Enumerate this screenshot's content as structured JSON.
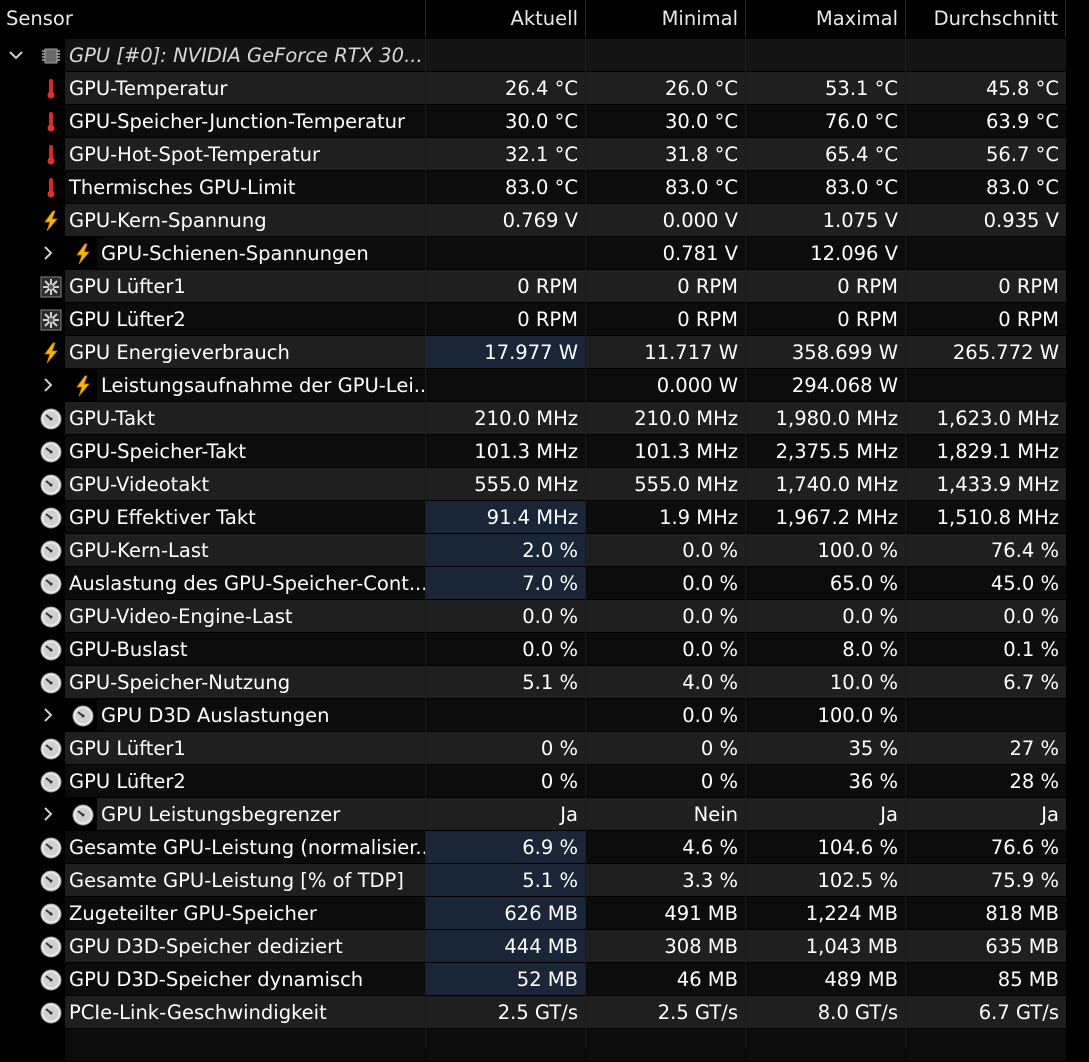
{
  "header": {
    "sensor": "Sensor",
    "current": "Aktuell",
    "min": "Minimal",
    "max": "Maximal",
    "avg": "Durchschnitt"
  },
  "group": {
    "label": "GPU [#0]: NVIDIA GeForce RTX 30...",
    "icon": "chip-icon"
  },
  "rows": [
    {
      "name": "GPU-Temperatur",
      "icon": "thermometer-icon",
      "cur": "26.4 °C",
      "min": "26.0 °C",
      "max": "53.1 °C",
      "avg": "45.8 °C"
    },
    {
      "name": "GPU-Speicher-Junction-Temperatur",
      "icon": "thermometer-icon",
      "cur": "30.0 °C",
      "min": "30.0 °C",
      "max": "76.0 °C",
      "avg": "63.9 °C"
    },
    {
      "name": "GPU-Hot-Spot-Temperatur",
      "icon": "thermometer-icon",
      "cur": "32.1 °C",
      "min": "31.8 °C",
      "max": "65.4 °C",
      "avg": "56.7 °C"
    },
    {
      "name": "Thermisches GPU-Limit",
      "icon": "thermometer-icon",
      "cur": "83.0 °C",
      "min": "83.0 °C",
      "max": "83.0 °C",
      "avg": "83.0 °C"
    },
    {
      "name": "GPU-Kern-Spannung",
      "icon": "lightning-icon",
      "cur": "0.769 V",
      "min": "0.000 V",
      "max": "1.075 V",
      "avg": "0.935 V"
    },
    {
      "name": "GPU-Schienen-Spannungen",
      "icon": "lightning-icon",
      "child": true,
      "cur": "",
      "min": "0.781 V",
      "max": "12.096 V",
      "avg": ""
    },
    {
      "name": "GPU Lüfter1",
      "icon": "fan-icon",
      "cur": "0 RPM",
      "min": "0 RPM",
      "max": "0 RPM",
      "avg": "0 RPM"
    },
    {
      "name": "GPU Lüfter2",
      "icon": "fan-icon",
      "cur": "0 RPM",
      "min": "0 RPM",
      "max": "0 RPM",
      "avg": "0 RPM"
    },
    {
      "name": "GPU Energieverbrauch",
      "icon": "lightning-icon",
      "cur": "17.977 W",
      "min": "11.717 W",
      "max": "358.699 W",
      "avg": "265.772 W",
      "hl": true
    },
    {
      "name": "Leistungsaufnahme der GPU-Lei...",
      "icon": "lightning-icon",
      "child": true,
      "cur": "",
      "min": "0.000 W",
      "max": "294.068 W",
      "avg": ""
    },
    {
      "name": "GPU-Takt",
      "icon": "gauge-icon",
      "cur": "210.0 MHz",
      "min": "210.0 MHz",
      "max": "1,980.0 MHz",
      "avg": "1,623.0 MHz"
    },
    {
      "name": "GPU-Speicher-Takt",
      "icon": "gauge-icon",
      "cur": "101.3 MHz",
      "min": "101.3 MHz",
      "max": "2,375.5 MHz",
      "avg": "1,829.1 MHz"
    },
    {
      "name": "GPU-Videotakt",
      "icon": "gauge-icon",
      "cur": "555.0 MHz",
      "min": "555.0 MHz",
      "max": "1,740.0 MHz",
      "avg": "1,433.9 MHz"
    },
    {
      "name": "GPU Effektiver Takt",
      "icon": "gauge-icon",
      "cur": "91.4 MHz",
      "min": "1.9 MHz",
      "max": "1,967.2 MHz",
      "avg": "1,510.8 MHz",
      "hl": true
    },
    {
      "name": "GPU-Kern-Last",
      "icon": "gauge-icon",
      "cur": "2.0 %",
      "min": "0.0 %",
      "max": "100.0 %",
      "avg": "76.4 %",
      "hl": true
    },
    {
      "name": "Auslastung des GPU-Speicher-Cont...",
      "icon": "gauge-icon",
      "cur": "7.0 %",
      "min": "0.0 %",
      "max": "65.0 %",
      "avg": "45.0 %",
      "hl": true
    },
    {
      "name": "GPU-Video-Engine-Last",
      "icon": "gauge-icon",
      "cur": "0.0 %",
      "min": "0.0 %",
      "max": "0.0 %",
      "avg": "0.0 %"
    },
    {
      "name": "GPU-Buslast",
      "icon": "gauge-icon",
      "cur": "0.0 %",
      "min": "0.0 %",
      "max": "8.0 %",
      "avg": "0.1 %"
    },
    {
      "name": "GPU-Speicher-Nutzung",
      "icon": "gauge-icon",
      "cur": "5.1 %",
      "min": "4.0 %",
      "max": "10.0 %",
      "avg": "6.7 %"
    },
    {
      "name": "GPU D3D Auslastungen",
      "icon": "gauge-icon",
      "child": true,
      "cur": "",
      "min": "0.0 %",
      "max": "100.0 %",
      "avg": ""
    },
    {
      "name": "GPU Lüfter1",
      "icon": "gauge-icon",
      "cur": "0 %",
      "min": "0 %",
      "max": "35 %",
      "avg": "27 %"
    },
    {
      "name": "GPU Lüfter2",
      "icon": "gauge-icon",
      "cur": "0 %",
      "min": "0 %",
      "max": "36 %",
      "avg": "28 %"
    },
    {
      "name": "GPU Leistungsbegrenzer",
      "icon": "gauge-icon",
      "child": true,
      "cur": "Ja",
      "min": "Nein",
      "max": "Ja",
      "avg": "Ja"
    },
    {
      "name": "Gesamte GPU-Leistung (normalisier...",
      "icon": "gauge-icon",
      "cur": "6.9 %",
      "min": "4.6 %",
      "max": "104.6 %",
      "avg": "76.6 %",
      "hl": true
    },
    {
      "name": "Gesamte GPU-Leistung [% of TDP]",
      "icon": "gauge-icon",
      "cur": "5.1 %",
      "min": "3.3 %",
      "max": "102.5 %",
      "avg": "75.9 %",
      "hl": true
    },
    {
      "name": "Zugeteilter GPU-Speicher",
      "icon": "gauge-icon",
      "cur": "626 MB",
      "min": "491 MB",
      "max": "1,224 MB",
      "avg": "818 MB",
      "hl": true
    },
    {
      "name": "GPU D3D-Speicher dediziert",
      "icon": "gauge-icon",
      "cur": "444 MB",
      "min": "308 MB",
      "max": "1,043 MB",
      "avg": "635 MB",
      "hl": true
    },
    {
      "name": "GPU D3D-Speicher dynamisch",
      "icon": "gauge-icon",
      "cur": "52 MB",
      "min": "46 MB",
      "max": "489 MB",
      "avg": "85 MB",
      "hl": true
    },
    {
      "name": "PCIe-Link-Geschwindigkeit",
      "icon": "gauge-icon",
      "cur": "2.5 GT/s",
      "min": "2.5 GT/s",
      "max": "8.0 GT/s",
      "avg": "6.7 GT/s"
    }
  ],
  "colors": {
    "highlight": "#1a2538",
    "row_odd": "#1f1f1f",
    "row_even": "#0c0c0c",
    "thermo_red": "#e03030",
    "bolt_yellow": "#f5b800"
  }
}
